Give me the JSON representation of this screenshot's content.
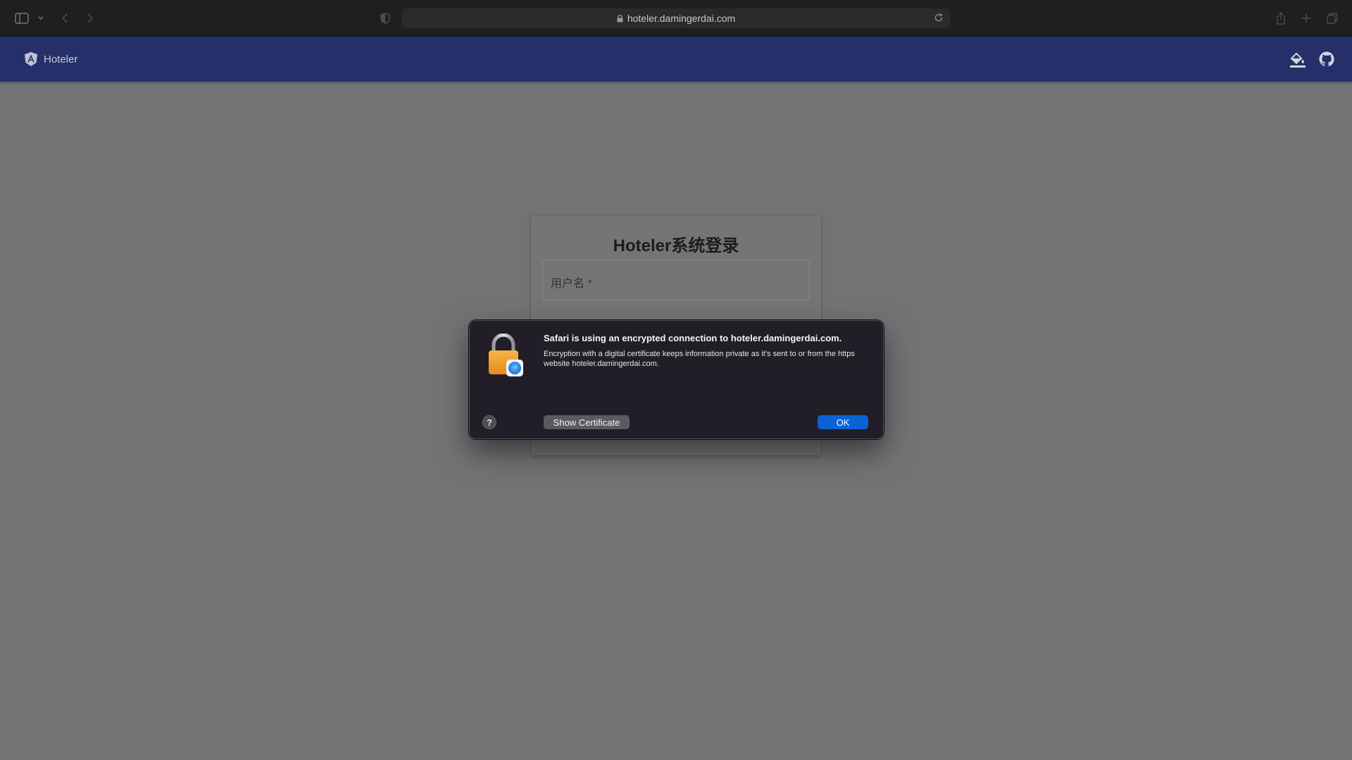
{
  "browser": {
    "url": "hoteler.damingerdai.com",
    "icons": {
      "sidebar": "sidebar-toggle-icon",
      "sidebar_menu": "chevron-down-icon",
      "back": "chevron-left-icon",
      "forward": "chevron-right-icon",
      "privacy": "shield-icon",
      "lock": "lock-icon",
      "reload": "reload-icon",
      "share": "share-icon",
      "new_tab": "plus-icon",
      "tabs": "tab-overview-icon"
    }
  },
  "header": {
    "brand_name": "Hoteler",
    "brand_icon": "angular-logo-icon",
    "actions": [
      "theme-paint-icon",
      "github-icon"
    ],
    "color": "#25306a"
  },
  "login": {
    "title": "Hoteler系统登录",
    "username_label": "用户名 *"
  },
  "dialog": {
    "title": "Safari is using an encrypted connection to hoteler.damingerdai.com.",
    "body": "Encryption with a digital certificate keeps information private as it’s sent to or from the https website hoteler.damingerdai.com.",
    "help_label": "?",
    "show_certificate_label": "Show Certificate",
    "ok_label": "OK",
    "icon": "padlock-safari-icon",
    "accent": "#0a63d6"
  }
}
